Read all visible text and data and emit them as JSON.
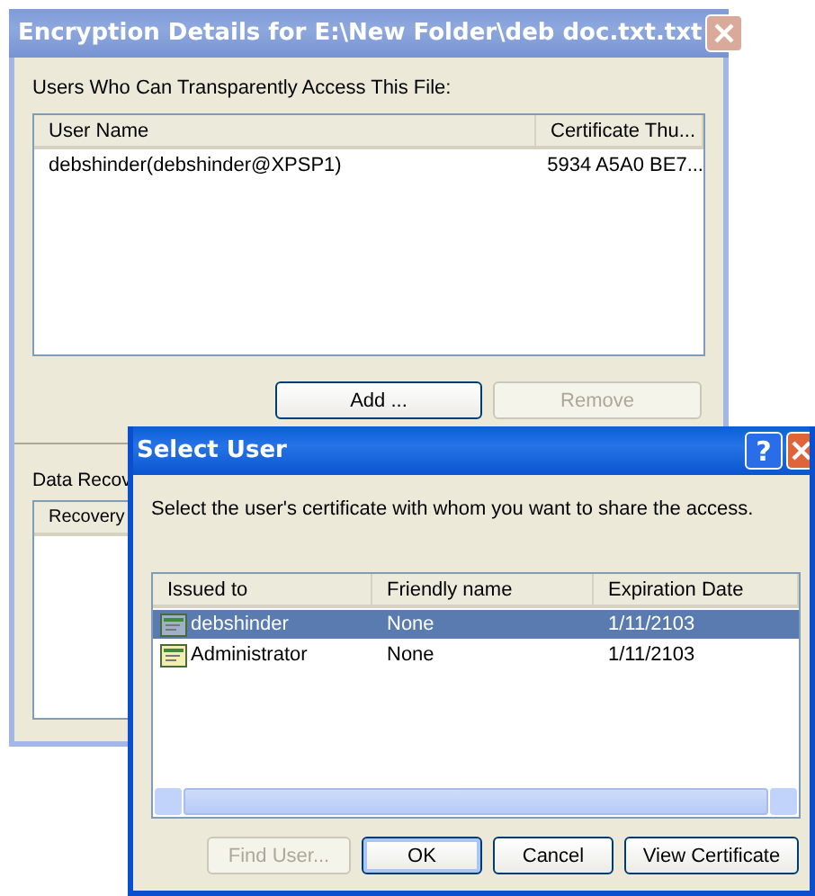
{
  "back_window": {
    "title": "Encryption Details for E:\\New Folder\\deb doc.txt.txt",
    "active": false,
    "users_label": "Users Who Can Transparently Access This File:",
    "users_list": {
      "columns": [
        "User Name",
        "Certificate Thu..."
      ],
      "rows": [
        {
          "cells": [
            "debshinder(debshinder@XPSP1)",
            "5934 A5A0 BE7..."
          ],
          "selected": false
        }
      ]
    },
    "buttons": [
      {
        "label": "Add ...",
        "disabled": false,
        "default": false
      },
      {
        "label": "Remove",
        "disabled": true,
        "default": false
      }
    ],
    "recovery_label": "Data Recov",
    "recovery_list": {
      "columns": [
        "Recovery"
      ]
    }
  },
  "front_window": {
    "title": "Select User",
    "active": true,
    "help": "?",
    "prompt": "Select the user's certificate with whom you want to share the access.",
    "cert_list": {
      "columns": [
        "Issued to",
        "Friendly name",
        "Expiration Date"
      ],
      "rows": [
        {
          "cells": [
            "debshinder",
            "None",
            "1/11/2103"
          ],
          "selected": true
        },
        {
          "cells": [
            "Administrator",
            "None",
            "1/11/2103"
          ],
          "selected": false
        }
      ]
    },
    "buttons": [
      {
        "label": "Find User...",
        "disabled": true,
        "default": false
      },
      {
        "label": "OK",
        "disabled": false,
        "default": true
      },
      {
        "label": "Cancel",
        "disabled": false,
        "default": false
      },
      {
        "label": "View Certificate",
        "disabled": false,
        "default": false
      }
    ]
  }
}
